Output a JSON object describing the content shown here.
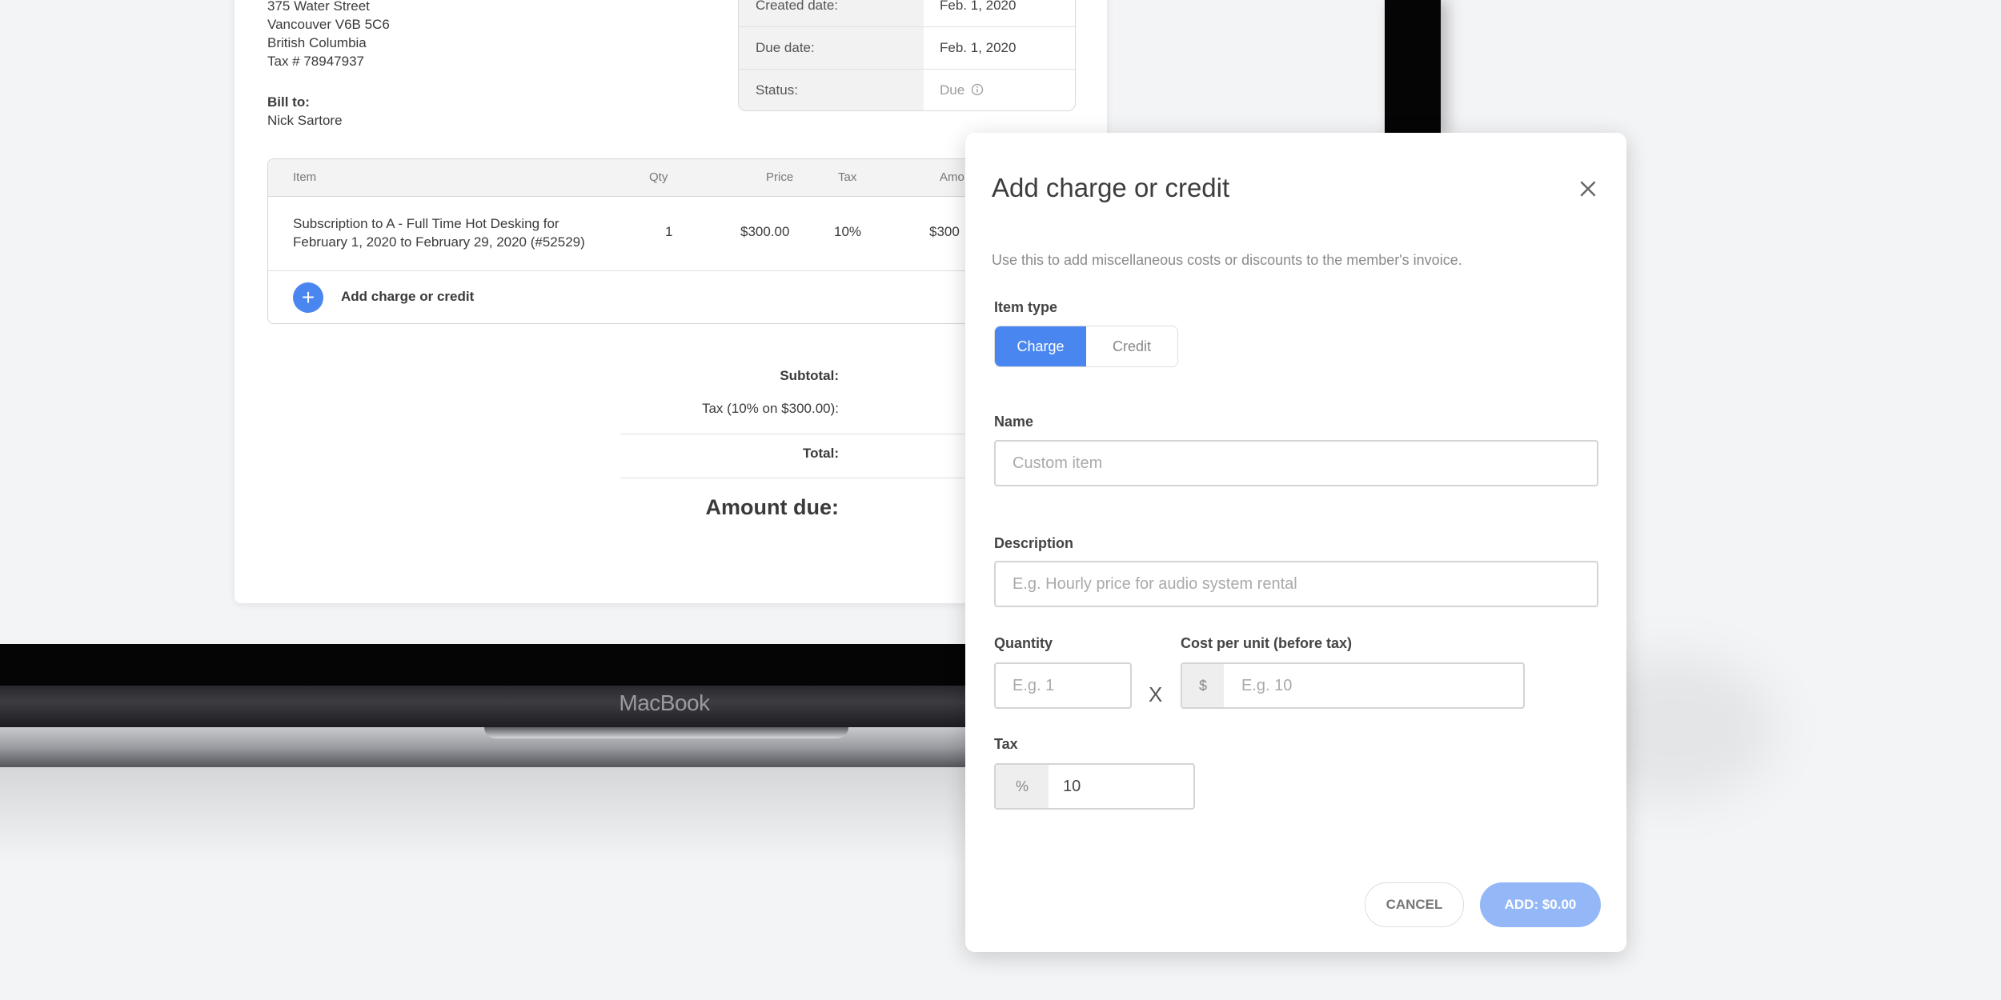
{
  "device": {
    "brand_label": "MacBook"
  },
  "invoice": {
    "address_lines": [
      "375 Water Street",
      "Vancouver V6B 5C6",
      "British Columbia",
      "Tax # 78947937"
    ],
    "bill_to_label": "Bill to:",
    "bill_to_name": "Nick Sartore",
    "meta": [
      {
        "label": "Created date:",
        "value": "Feb. 1, 2020"
      },
      {
        "label": "Due date:",
        "value": "Feb. 1, 2020"
      },
      {
        "label": "Status:",
        "value": "Due"
      }
    ],
    "table": {
      "headers": {
        "item": "Item",
        "qty": "Qty",
        "price": "Price",
        "tax": "Tax",
        "amount": "Amo"
      },
      "rows": [
        {
          "item_line1": "Subscription to A - Full Time Hot Desking for",
          "item_line2": "February 1, 2020 to February 29, 2020 (#52529)",
          "qty": "1",
          "price": "$300.00",
          "tax": "10%",
          "amount": "$300"
        }
      ],
      "add_label": "Add charge or credit"
    },
    "totals": {
      "subtotal_label": "Subtotal:",
      "tax_label": "Tax (10% on $300.00):",
      "total_label": "Total:",
      "amount_due_label": "Amount due:"
    }
  },
  "modal": {
    "title": "Add charge or credit",
    "subtitle": "Use this to add miscellaneous costs or discounts to the member's invoice.",
    "item_type_label": "Item type",
    "item_type_options": [
      "Charge",
      "Credit"
    ],
    "item_type_selected": "Charge",
    "name_label": "Name",
    "name_placeholder": "Custom item",
    "description_label": "Description",
    "description_placeholder": "E.g. Hourly price for audio system rental",
    "quantity_label": "Quantity",
    "quantity_placeholder": "E.g. 1",
    "multiply_symbol": "X",
    "cost_label": "Cost per unit (before tax)",
    "cost_prefix": "$",
    "cost_placeholder": "E.g. 10",
    "tax_label": "Tax",
    "tax_prefix": "%",
    "tax_value": "10",
    "cancel_label": "CANCEL",
    "add_label": "ADD: $0.00"
  },
  "colors": {
    "accent": "#4a86f0",
    "accent_disabled": "#94b7f7"
  }
}
